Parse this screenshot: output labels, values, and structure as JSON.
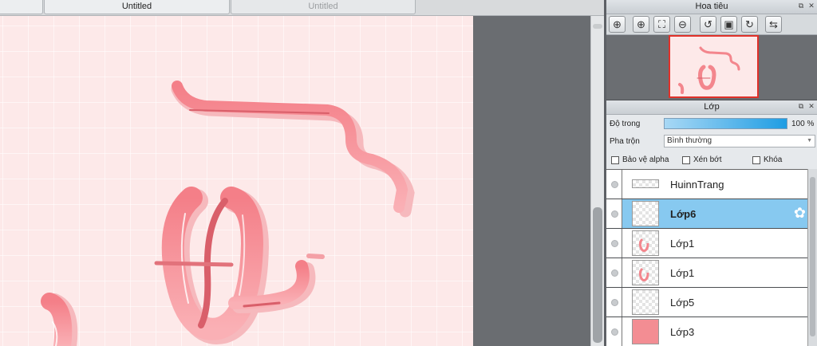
{
  "tabs": [
    {
      "label": "Untitled",
      "active": true
    },
    {
      "label": "Untitled",
      "active": false
    }
  ],
  "navigator": {
    "title": "Hoa tiêu",
    "tools": [
      {
        "icon": "zoom-in-icon",
        "glyph": "⊕"
      },
      {
        "icon": "zoom-in-icon",
        "glyph": "⊕"
      },
      {
        "icon": "fit-screen-icon",
        "glyph": "⛶"
      },
      {
        "icon": "zoom-out-icon",
        "glyph": "⊖"
      },
      {
        "icon": "rotate-left-icon",
        "glyph": "↺"
      },
      {
        "icon": "actual-size-icon",
        "glyph": "▣"
      },
      {
        "icon": "rotate-right-icon",
        "glyph": "↻"
      },
      {
        "icon": "flip-horizontal-icon",
        "glyph": "⇆"
      }
    ]
  },
  "layers_panel": {
    "title": "Lớp",
    "opacity_label": "Độ trong",
    "opacity_value": "100 %",
    "blend_label": "Pha trộn",
    "blend_value": "Bình thường",
    "protect_alpha_label": "Bảo vệ alpha",
    "clipping_label": "Xén bớt",
    "lock_label": "Khóa",
    "layers": [
      {
        "name": "HuinnTrang",
        "thumb": "text",
        "selected": false
      },
      {
        "name": "Lớp6",
        "thumb": "empty",
        "selected": true
      },
      {
        "name": "Lớp1",
        "thumb": "art",
        "selected": false
      },
      {
        "name": "Lớp1",
        "thumb": "art",
        "selected": false
      },
      {
        "name": "Lớp5",
        "thumb": "empty",
        "selected": false
      },
      {
        "name": "Lớp3",
        "thumb": "solid",
        "selected": false
      }
    ]
  },
  "colors": {
    "canvas_bg": "#fde9e9",
    "ribbon": "#f3868d",
    "ribbon_dark": "#d95f6a",
    "selection": "#87c9f0",
    "accent_red": "#e0312a"
  }
}
